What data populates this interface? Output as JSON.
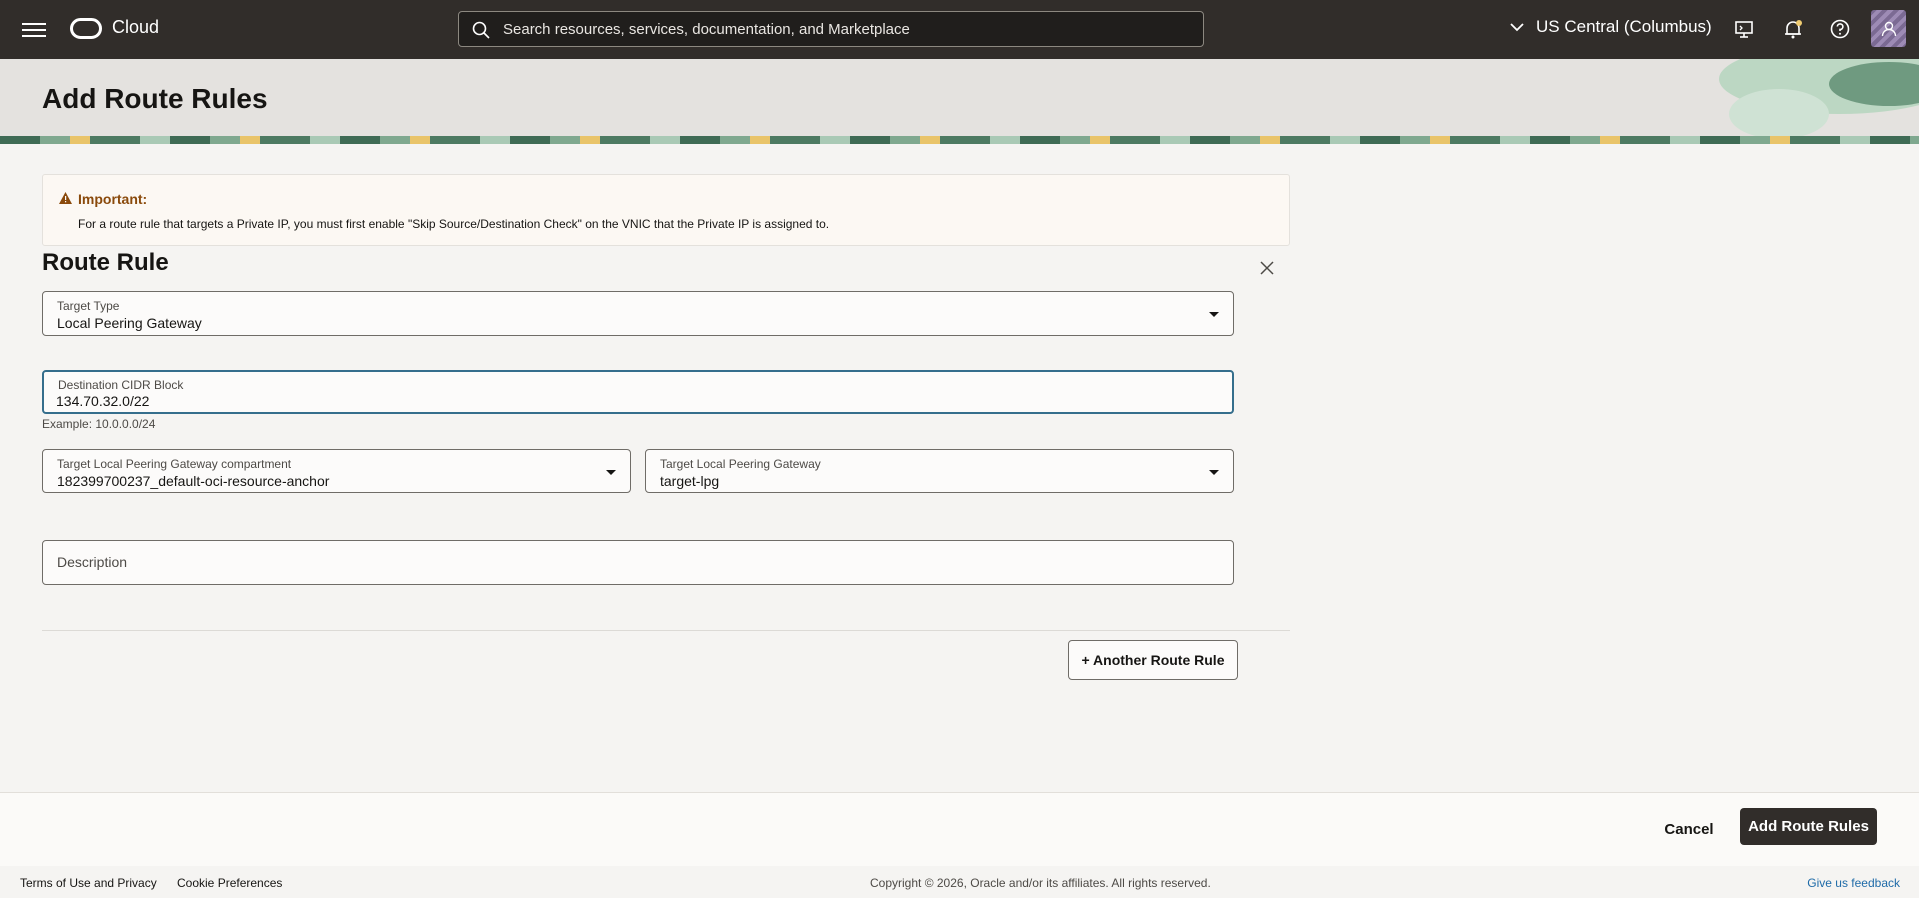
{
  "nav": {
    "brand": "Cloud",
    "search_placeholder": "Search resources, services, documentation, and Marketplace",
    "region": "US Central (Columbus)"
  },
  "header": {
    "title": "Add Route Rules"
  },
  "alert": {
    "title": "Important:",
    "text": "For a route rule that targets a Private IP, you must first enable \"Skip Source/Destination Check\" on the VNIC that the Private IP is assigned to."
  },
  "route_rule": {
    "title": "Route Rule",
    "target_type": {
      "label": "Target Type",
      "value": "Local Peering Gateway"
    },
    "destination_cidr": {
      "label": "Destination CIDR Block",
      "value": "134.70.32.0/22",
      "hint": "Example: 10.0.0.0/24"
    },
    "compartment": {
      "label": "Target Local Peering Gateway compartment",
      "value": "182399700237_default-oci-resource-anchor"
    },
    "target_lpg": {
      "label": "Target Local Peering Gateway",
      "value": "target-lpg"
    },
    "description": {
      "placeholder": "Description"
    }
  },
  "buttons": {
    "another_rule": "+ Another Route Rule",
    "cancel": "Cancel",
    "submit": "Add Route Rules"
  },
  "footer": {
    "terms": "Terms of Use and Privacy",
    "cookies": "Cookie Preferences",
    "copyright": "Copyright © 2026, Oracle and/or its affiliates. All rights reserved.",
    "feedback": "Give us feedback"
  },
  "colors": {
    "topbar": "#312d2a",
    "primary_button": "#312d2a",
    "focus_border": "#356e8c",
    "alert_title": "#8a4a0b",
    "link": "#1f6ba8"
  },
  "icons": [
    "menu-icon",
    "oracle-logo-icon",
    "search-icon",
    "chevron-down-icon",
    "cloud-shell-icon",
    "bell-icon",
    "help-icon",
    "user-icon",
    "warning-icon",
    "close-icon"
  ]
}
